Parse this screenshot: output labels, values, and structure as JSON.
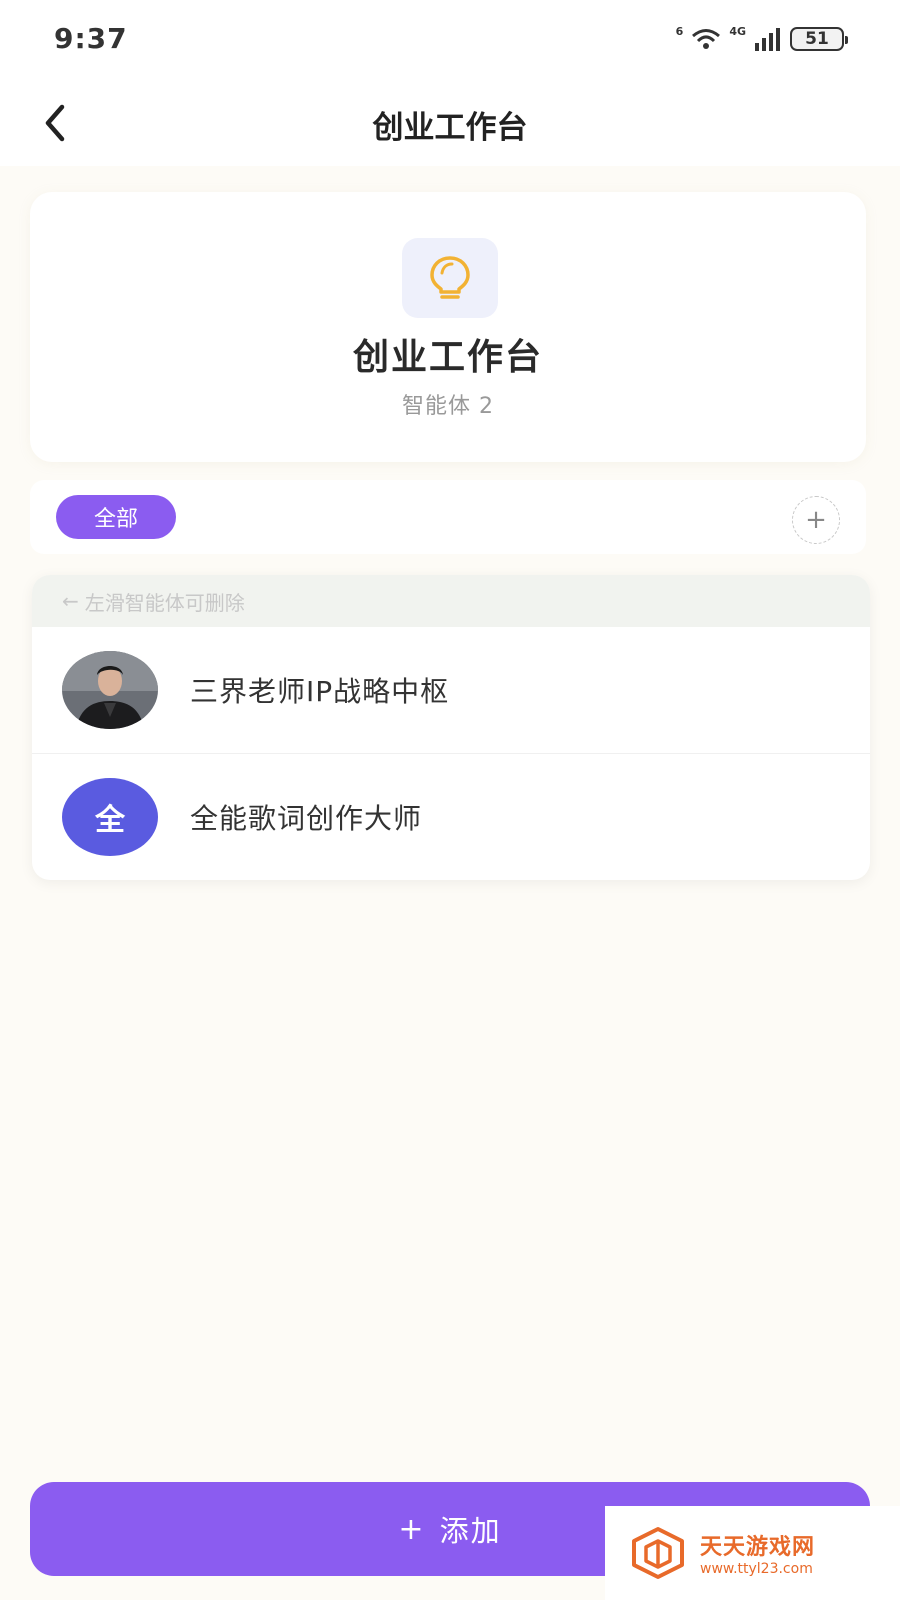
{
  "status_bar": {
    "time": "9:37",
    "network_label": "6",
    "cell_label": "4G",
    "battery": "51"
  },
  "header": {
    "title": "创业工作台"
  },
  "info_card": {
    "title": "创业工作台",
    "subtitle": "智能体 2",
    "icon": "lightbulb-icon"
  },
  "filter": {
    "active_chip": "全部",
    "add_icon": "plus-icon"
  },
  "list": {
    "hint": "左滑智能体可删除",
    "items": [
      {
        "name": "三界老师IP战略中枢",
        "avatar": "photo"
      },
      {
        "name": "全能歌词创作大师",
        "avatar_letter": "全"
      }
    ]
  },
  "bottom": {
    "add_label": "添加",
    "add_plus": "+"
  },
  "watermark": {
    "name": "天天游戏网",
    "url": "www.ttyl23.com"
  },
  "colors": {
    "accent": "#8b5cf0",
    "avatar_blue": "#5a5be0",
    "bulb": "#f2b233",
    "watermark": "#e86a2a"
  }
}
